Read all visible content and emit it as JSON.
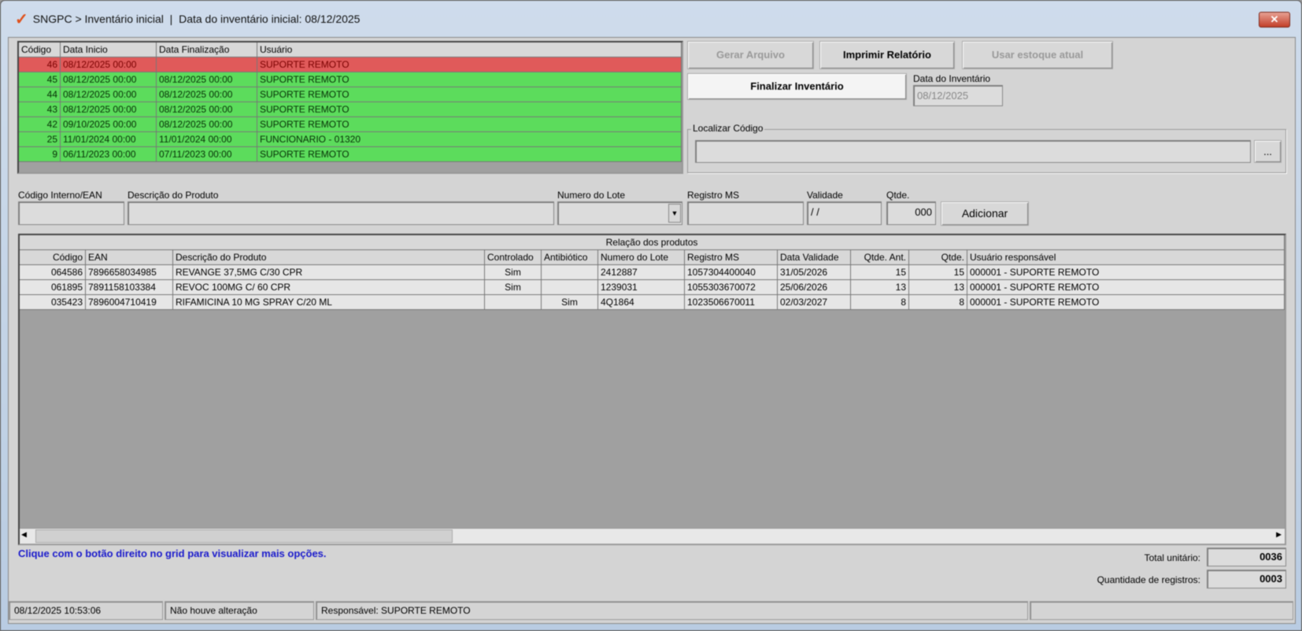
{
  "window": {
    "title": "SNGPC > Inventário inicial  |  Data do inventário inicial: 08/12/2025",
    "close": "✕"
  },
  "inventories": {
    "headers": [
      "Código",
      "Data Inicio",
      "Data Finalização",
      "Usuário"
    ],
    "rows": [
      {
        "codigo": "46",
        "inicio": "08/12/2025 00:00",
        "fim": "",
        "usuario": "SUPORTE REMOTO",
        "status": "open"
      },
      {
        "codigo": "45",
        "inicio": "08/12/2025 00:00",
        "fim": "08/12/2025 00:00",
        "usuario": "SUPORTE REMOTO",
        "status": "closed"
      },
      {
        "codigo": "44",
        "inicio": "08/12/2025 00:00",
        "fim": "08/12/2025 00:00",
        "usuario": "SUPORTE REMOTO",
        "status": "closed"
      },
      {
        "codigo": "43",
        "inicio": "08/12/2025 00:00",
        "fim": "08/12/2025 00:00",
        "usuario": "SUPORTE REMOTO",
        "status": "closed"
      },
      {
        "codigo": "42",
        "inicio": "09/10/2025 00:00",
        "fim": "08/12/2025 00:00",
        "usuario": "SUPORTE REMOTO",
        "status": "closed"
      },
      {
        "codigo": "25",
        "inicio": "11/01/2024 00:00",
        "fim": "11/01/2024 00:00",
        "usuario": "FUNCIONARIO - 01320",
        "status": "closed"
      },
      {
        "codigo": "9",
        "inicio": "06/11/2023 00:00",
        "fim": "07/11/2023 00:00",
        "usuario": "SUPORTE REMOTO",
        "status": "closed"
      }
    ]
  },
  "actions": {
    "gerar": "Gerar Arquivo",
    "imprimir": "Imprimir Relatório",
    "usar": "Usar estoque atual",
    "finalizar": "Finalizar Inventário"
  },
  "data_inventario": {
    "label": "Data do Inventário",
    "value": "08/12/2025"
  },
  "localizar": {
    "label": "Localizar Código",
    "value": "",
    "browse": "..."
  },
  "entry": {
    "codigo_label": "Código Interno/EAN",
    "descricao_label": "Descrição do Produto",
    "lote_label": "Numero do Lote",
    "registro_label": "Registro MS",
    "validade_label": "Validade",
    "validade_value": "/ /",
    "qtde_label": "Qtde.",
    "qtde_value": "000",
    "adicionar": "Adicionar"
  },
  "products": {
    "title": "Relação dos produtos",
    "headers": [
      "Código",
      "EAN",
      "Descrição do Produto",
      "Controlado",
      "Antibiótico",
      "Numero do Lote",
      "Registro MS",
      "Data Validade",
      "Qtde. Ant.",
      "Qtde.",
      "Usuário responsável"
    ],
    "rows": [
      [
        "064586",
        "7896658034985",
        "REVANGE 37,5MG C/30 CPR",
        "Sim",
        "",
        "2412887",
        "1057304400040",
        "31/05/2026",
        "15",
        "15",
        "000001 - SUPORTE REMOTO"
      ],
      [
        "061895",
        "7891158103384",
        "REVOC 100MG C/ 60 CPR",
        "Sim",
        "",
        "1239031",
        "1055303670072",
        "25/06/2026",
        "13",
        "13",
        "000001 - SUPORTE REMOTO"
      ],
      [
        "035423",
        "7896004710419",
        "RIFAMICINA 10 MG SPRAY C/20 ML",
        "",
        "Sim",
        "4Q1864",
        "1023506670011",
        "02/03/2027",
        "8",
        "8",
        "000001 - SUPORTE REMOTO"
      ]
    ]
  },
  "hint": "Clique com o botão direito no grid para visualizar mais opções.",
  "totals": {
    "unit_label": "Total unitário:",
    "unit_value": "0036",
    "count_label": "Quantidade de registros:",
    "count_value": "0003"
  },
  "status": {
    "datetime": "08/12/2025 10:53:06",
    "changes": "Não houve alteração",
    "responsavel": "Responsável: SUPORTE REMOTO"
  },
  "colors": {
    "open": "#e05a5a",
    "closed": "#5cdc5c",
    "hint": "#1a1acc"
  }
}
